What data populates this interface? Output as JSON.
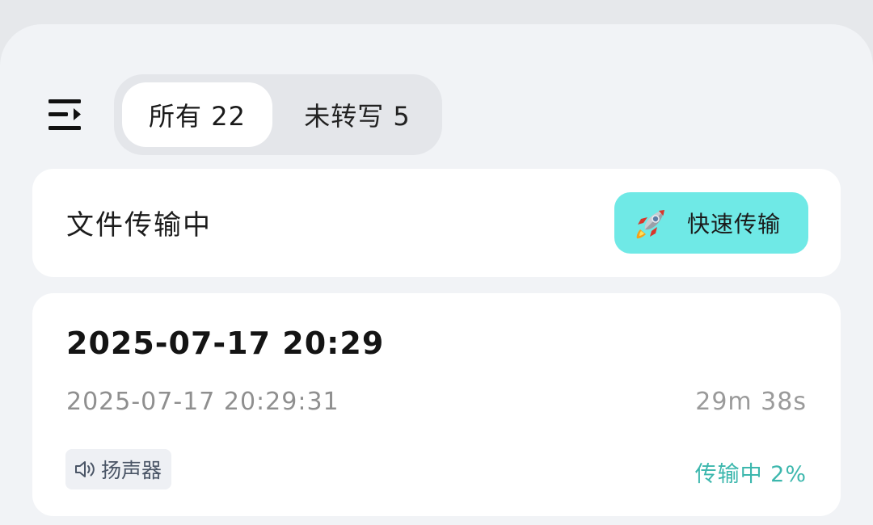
{
  "tabs": [
    {
      "label": "所有 22",
      "active": true
    },
    {
      "label": "未转写 5",
      "active": false
    }
  ],
  "transfer": {
    "title": "文件传输中",
    "fast_button_label": "快速传输",
    "fast_button_icon": "rocket-icon",
    "accent": "#6fe9e6"
  },
  "recording": {
    "title": "2025-07-17 20:29",
    "timestamp": "2025-07-17 20:29:31",
    "duration": "29m 38s",
    "source_tag": "扬声器",
    "source_icon": "speaker-icon",
    "status": "传输中 2%",
    "status_color": "#3cb7ad",
    "progress_percent": 2
  },
  "header": {
    "menu_icon": "menu-collapse-icon"
  }
}
